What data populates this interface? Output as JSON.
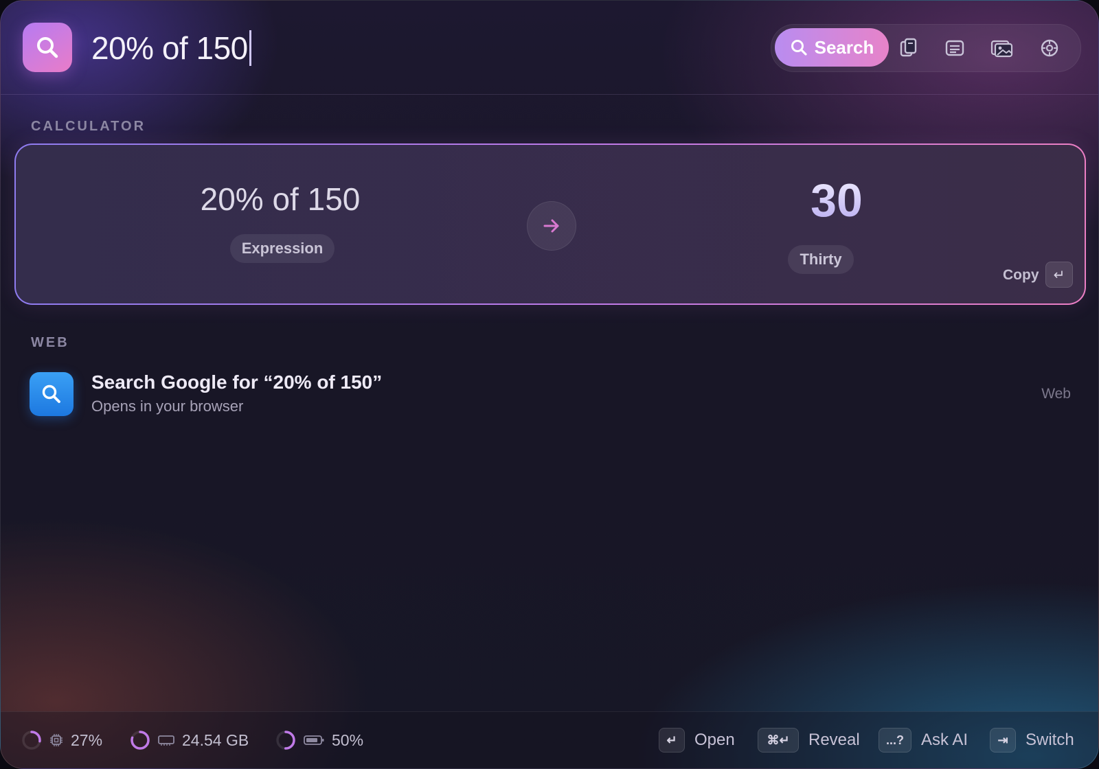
{
  "search": {
    "query": "20% of 150"
  },
  "toolbar": {
    "search_label": "Search",
    "buttons": [
      "clipboard-icon",
      "notes-icon",
      "images-icon",
      "settings-icon"
    ]
  },
  "calculator": {
    "section_label": "CALCULATOR",
    "expression": "20% of 150",
    "expression_tag": "Expression",
    "result": "30",
    "result_words": "Thirty",
    "copy_label": "Copy",
    "copy_key": "↵"
  },
  "web": {
    "section_label": "WEB",
    "title": "Search Google for “20% of 150”",
    "subtitle": "Opens in your browser",
    "tag": "Web"
  },
  "footer": {
    "cpu": {
      "value": "27%",
      "level": 0.27
    },
    "memory": {
      "value": "24.54 GB"
    },
    "battery": {
      "value": "50%",
      "level": 0.5
    },
    "actions": [
      {
        "key": "↵",
        "label": "Open"
      },
      {
        "key": "⌘↵",
        "label": "Reveal"
      },
      {
        "key": "...?",
        "label": "Ask AI"
      },
      {
        "key": "⇥",
        "label": "Switch"
      }
    ]
  },
  "colors": {
    "accent_start": "#b98cf0",
    "accent_end": "#e783c9",
    "web_icon": "#2a8cf0"
  }
}
